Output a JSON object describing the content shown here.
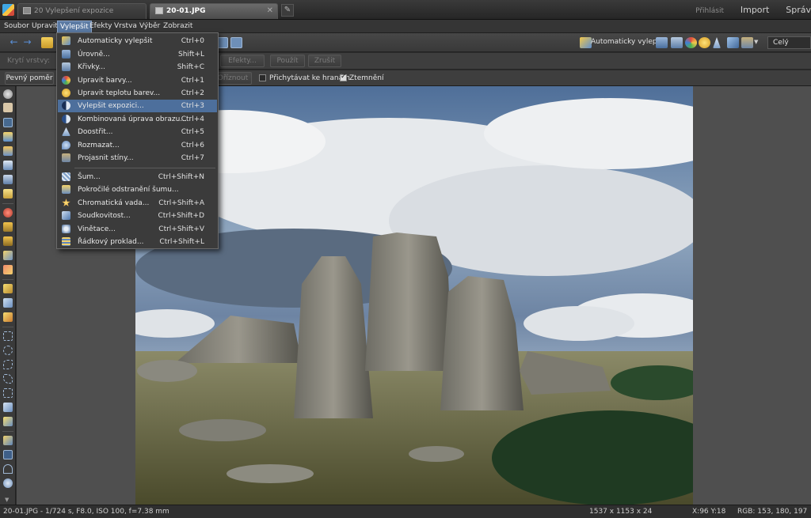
{
  "tabs": [
    {
      "label": "20 Vylepšení expozice",
      "active": false
    },
    {
      "label": "20-01.JPG",
      "active": true
    }
  ],
  "title_links": {
    "login": "Přihlásit",
    "import": "Import",
    "manage": "Správ"
  },
  "menu": [
    "Soubor",
    "Upravit",
    "Vylepšit",
    "Efekty",
    "Vrstva",
    "Výběr",
    "Zobrazit"
  ],
  "toolbar": {
    "auto_enhance_label": "Automaticky vylepšit",
    "zoom_value": "Celý"
  },
  "options": {
    "opacity_label": "Krytí vrstvy:",
    "effects_button": "Efekty...",
    "apply_button": "Použít",
    "cancel_button": "Zrušit",
    "ratio_button": "Pevný poměr",
    "crop_button": "Oříznout",
    "snap_label": "Přichytávat ke hranám",
    "darken_label": "Ztemnění"
  },
  "dropdown": {
    "items": [
      {
        "label": "Automaticky vylepšit",
        "shortcut": "Ctrl+0",
        "icon": "auto-enhance-icon"
      },
      {
        "label": "Úrovně...",
        "shortcut": "Shift+L",
        "icon": "levels-icon"
      },
      {
        "label": "Křivky...",
        "shortcut": "Shift+C",
        "icon": "curves-icon"
      },
      {
        "label": "Upravit barvy...",
        "shortcut": "Ctrl+1",
        "icon": "colors-icon"
      },
      {
        "label": "Upravit teplotu barev...",
        "shortcut": "Ctrl+2",
        "icon": "temperature-icon"
      },
      {
        "label": "Vylepšit expozici...",
        "shortcut": "Ctrl+3",
        "icon": "exposure-icon"
      },
      {
        "label": "Kombinovaná úprava obrazu...",
        "shortcut": "Ctrl+4",
        "icon": "combined-icon"
      },
      {
        "label": "Doostřit...",
        "shortcut": "Ctrl+5",
        "icon": "sharpen-icon"
      },
      {
        "label": "Rozmazat...",
        "shortcut": "Ctrl+6",
        "icon": "blur-icon"
      },
      {
        "label": "Projasnit stíny...",
        "shortcut": "Ctrl+7",
        "icon": "shadows-icon"
      },
      {
        "label": "Šum...",
        "shortcut": "Ctrl+Shift+N",
        "icon": "noise-icon"
      },
      {
        "label": "Pokročilé odstranění šumu...",
        "shortcut": "",
        "icon": "denoise-icon"
      },
      {
        "label": "Chromatická vada...",
        "shortcut": "Ctrl+Shift+A",
        "icon": "chromatic-icon"
      },
      {
        "label": "Soudkovitost...",
        "shortcut": "Ctrl+Shift+D",
        "icon": "barrel-icon"
      },
      {
        "label": "Vinětace...",
        "shortcut": "Ctrl+Shift+V",
        "icon": "vignette-icon"
      },
      {
        "label": "Řádkový proklad...",
        "shortcut": "Ctrl+Shift+L",
        "icon": "interlace-icon"
      }
    ]
  },
  "status": {
    "file_info": "20-01.JPG - 1/724 s, F8.0, ISO 100, f=7.38 mm",
    "dimensions": "1537 x 1153 x 24",
    "cursor": "X:96 Y:18",
    "rgb": "RGB: 153, 180, 197"
  },
  "colors": {
    "highlight": "#4d6f9c",
    "menu_active": "#5b7aa3",
    "accent_arrow": "#5a8fd6"
  }
}
